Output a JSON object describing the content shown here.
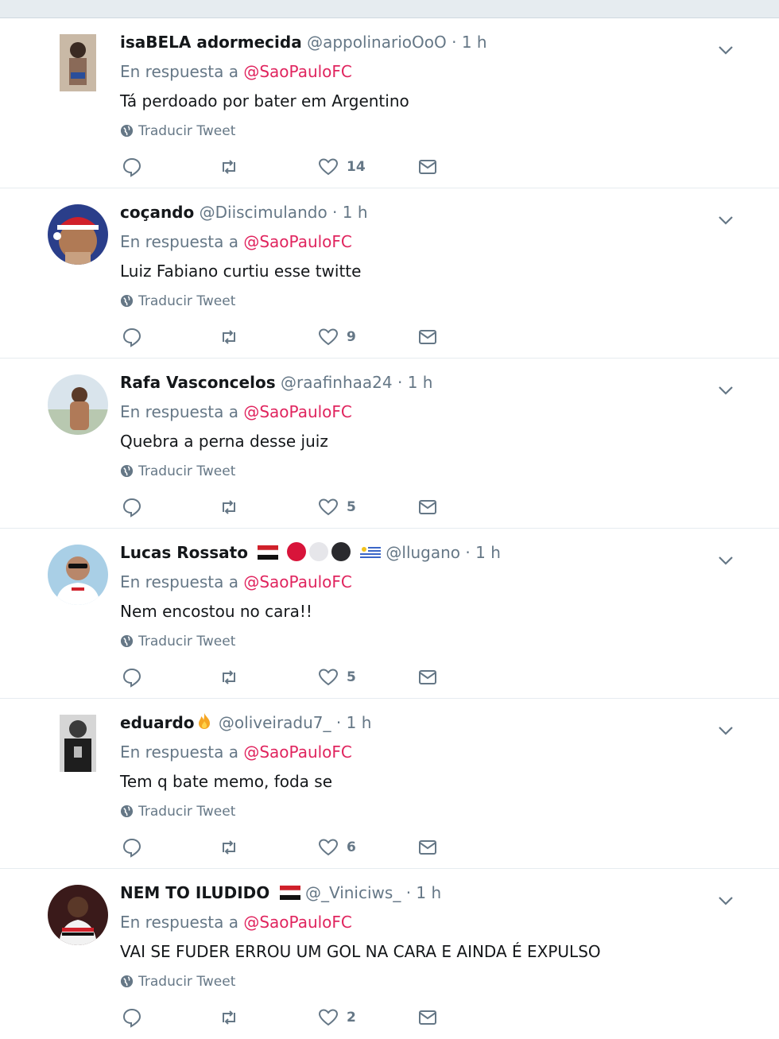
{
  "replying_prefix": "En respuesta a",
  "mention": "@SaoPauloFC",
  "translate_label": "Traducir Tweet",
  "separator": "·",
  "colors": {
    "mention": "#e0245e",
    "muted": "#657786",
    "text": "#14171a",
    "divider": "#e6ecf0"
  },
  "icons": [
    "reply-icon",
    "retweet-icon",
    "like-icon",
    "dm-icon",
    "caret-down-icon",
    "globe-icon"
  ],
  "tweets": [
    {
      "name": "isaBELA adormecida",
      "handle": "@appolinarioOoO",
      "time": "1 h",
      "text": "Tá perdoado por bater em Argentino",
      "likes": "14"
    },
    {
      "name": "coçando",
      "handle": "@Diiscimulando",
      "time": "1 h",
      "text": "Luiz Fabiano curtiu esse twitte",
      "likes": "9"
    },
    {
      "name": "Rafa Vasconcelos",
      "handle": "@raafinhaa24",
      "time": "1 h",
      "text": "Quebra a perna desse juiz",
      "likes": "5"
    },
    {
      "name": "Lucas Rossato",
      "handle": "@llugano",
      "time": "1 h",
      "text": "Nem encostou no cara!!",
      "likes": "5"
    },
    {
      "name": "eduardo",
      "handle": "@oliveiradu7_",
      "time": "1 h",
      "text": "Tem q bate memo, foda se",
      "likes": "6"
    },
    {
      "name": "NEM TO ILUDIDO",
      "handle": "@_Viniciws_",
      "time": "1 h",
      "text": "VAI SE FUDER ERROU UM GOL NA CARA E AINDA É EXPULSO",
      "likes": "2"
    }
  ]
}
